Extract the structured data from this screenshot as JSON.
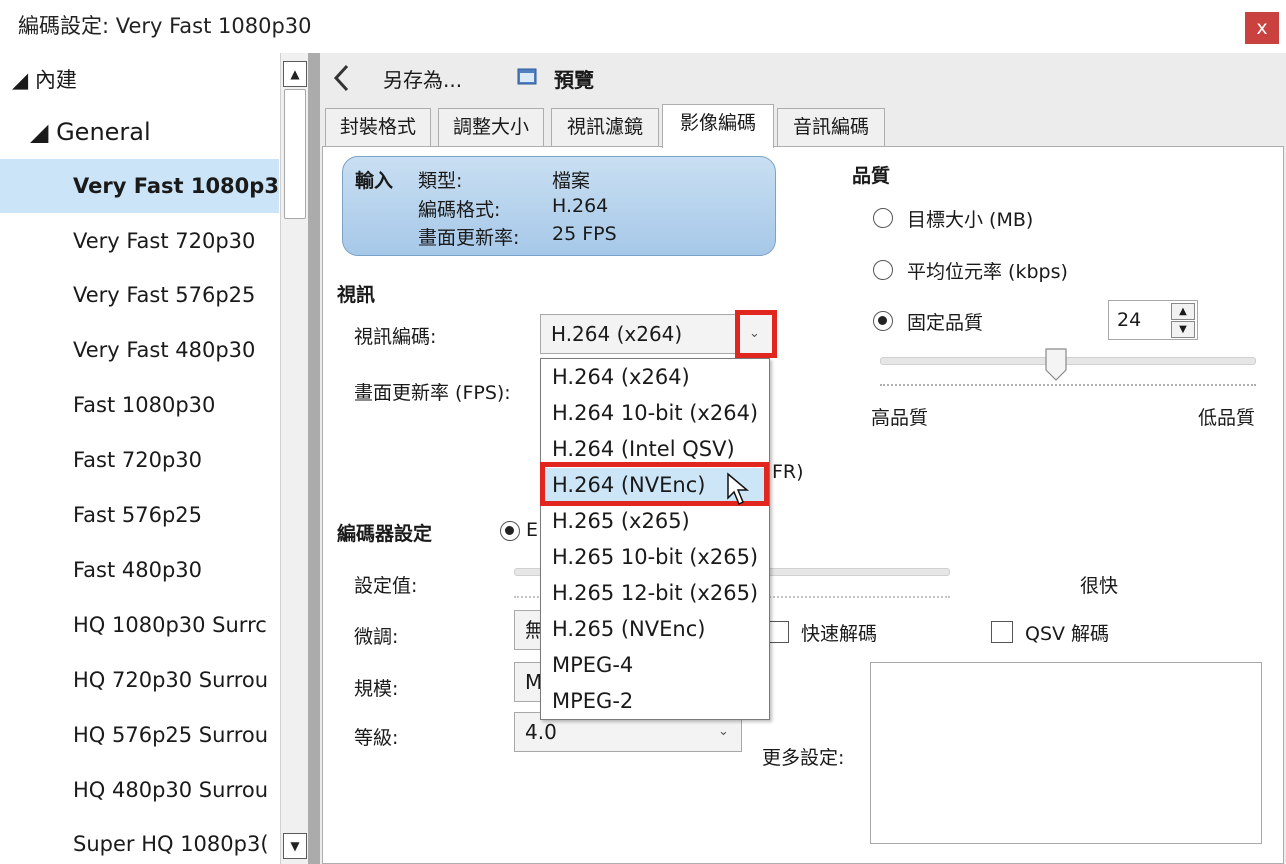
{
  "window": {
    "title": "編碼設定: Very Fast 1080p30",
    "close_glyph": "x"
  },
  "tree": {
    "root": "◢ 內建",
    "group": "◢ General",
    "items": [
      "Very Fast 1080p3(",
      "Very Fast 720p30",
      "Very Fast 576p25",
      "Very Fast 480p30",
      "Fast 1080p30",
      "Fast 720p30",
      "Fast 576p25",
      "Fast 480p30",
      "HQ 1080p30 Surrc",
      "HQ 720p30 Surrou",
      "HQ 576p25 Surrou",
      "HQ 480p30 Surrou",
      "Super HQ 1080p3("
    ]
  },
  "toolbar": {
    "save_as": "另存為...",
    "preview": "預覽"
  },
  "tabs": [
    "封裝格式",
    "調整大小",
    "視訊濾鏡",
    "影像編碼",
    "音訊編碼"
  ],
  "input": {
    "heading": "輸入",
    "type_label": "類型:",
    "type_value": "檔案",
    "codec_label": "編碼格式:",
    "codec_value": "H.264",
    "fps_label": "畫面更新率:",
    "fps_value": "25 FPS"
  },
  "video": {
    "section": "視訊",
    "codec_label": "視訊編碼:",
    "codec_selected": "H.264 (x264)",
    "fps_label": "畫面更新率 (FPS):",
    "hidden_fragment": "FR)",
    "codec_options": [
      "H.264 (x264)",
      "H.264 10-bit (x264)",
      "H.264 (Intel QSV)",
      "H.264 (NVEnc)",
      "H.265 (x265)",
      "H.265 10-bit (x265)",
      "H.265 12-bit (x265)",
      "H.265 (NVEnc)",
      "MPEG-4",
      "MPEG-2"
    ],
    "highlighted_option": "H.264 (NVEnc)"
  },
  "quality": {
    "section": "品質",
    "target_size": "目標大小 (MB)",
    "avg_bitrate": "平均位元率 (kbps)",
    "constant_quality": "固定品質",
    "selected": "固定品質",
    "value": "24",
    "slider_level": 0.48,
    "high_label": "高品質",
    "low_label": "低品質"
  },
  "encoder": {
    "section": "編碼器設定",
    "radio_fragment": "E",
    "preset_label": "設定值:",
    "preset_value_label": "很快",
    "tune_label": "微調:",
    "tune_value_fragment": "無",
    "fast_decode": "快速解碼",
    "qsv_decode": "QSV 解碼",
    "profile_label": "規模:",
    "profile_value_fragment": "M",
    "level_label": "等級:",
    "level_value": "4.0",
    "more_settings_label": "更多設定:"
  },
  "colors": {
    "accent_red": "#e0261f",
    "selection": "#cce4f7",
    "close": "#c9423f"
  },
  "icons": {
    "back": "chevron-left-icon",
    "preview": "preview-window-icon",
    "close": "close-icon",
    "cursor": "mouse-pointer-icon"
  }
}
